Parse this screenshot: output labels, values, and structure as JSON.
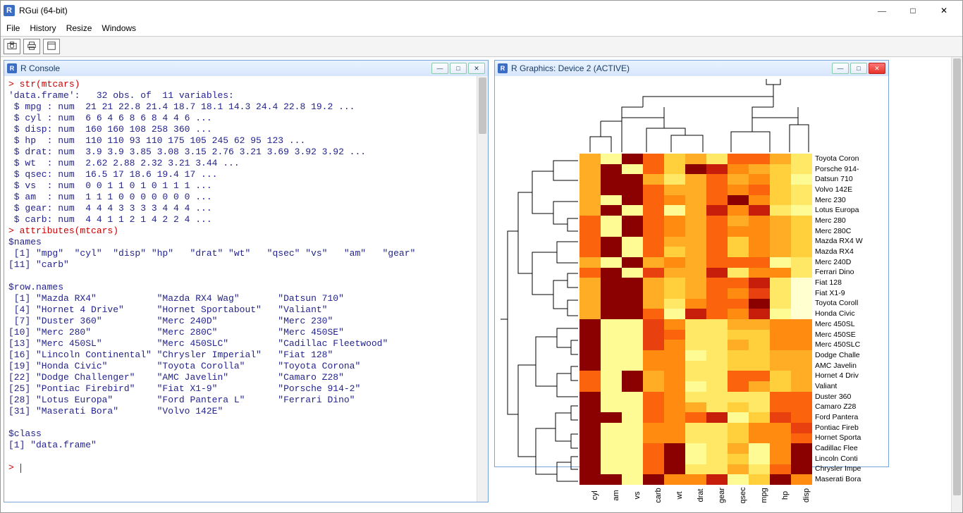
{
  "app": {
    "title": "RGui (64-bit)",
    "menus": [
      "File",
      "History",
      "Resize",
      "Windows"
    ]
  },
  "console": {
    "title": "R Console",
    "lines": [
      {
        "s": "cmd",
        "t": "> str(mtcars)"
      },
      {
        "s": "out",
        "t": "'data.frame':   32 obs. of  11 variables:"
      },
      {
        "s": "out",
        "t": " $ mpg : num  21 21 22.8 21.4 18.7 18.1 14.3 24.4 22.8 19.2 ..."
      },
      {
        "s": "out",
        "t": " $ cyl : num  6 6 4 6 8 6 8 4 4 6 ..."
      },
      {
        "s": "out",
        "t": " $ disp: num  160 160 108 258 360 ..."
      },
      {
        "s": "out",
        "t": " $ hp  : num  110 110 93 110 175 105 245 62 95 123 ..."
      },
      {
        "s": "out",
        "t": " $ drat: num  3.9 3.9 3.85 3.08 3.15 2.76 3.21 3.69 3.92 3.92 ..."
      },
      {
        "s": "out",
        "t": " $ wt  : num  2.62 2.88 2.32 3.21 3.44 ..."
      },
      {
        "s": "out",
        "t": " $ qsec: num  16.5 17 18.6 19.4 17 ..."
      },
      {
        "s": "out",
        "t": " $ vs  : num  0 0 1 1 0 1 0 1 1 1 ..."
      },
      {
        "s": "out",
        "t": " $ am  : num  1 1 1 0 0 0 0 0 0 0 ..."
      },
      {
        "s": "out",
        "t": " $ gear: num  4 4 4 3 3 3 3 4 4 4 ..."
      },
      {
        "s": "out",
        "t": " $ carb: num  4 4 1 1 2 1 4 2 2 4 ..."
      },
      {
        "s": "cmd",
        "t": "> attributes(mtcars)"
      },
      {
        "s": "out",
        "t": "$names"
      },
      {
        "s": "out",
        "t": " [1] \"mpg\"  \"cyl\"  \"disp\" \"hp\"   \"drat\" \"wt\"   \"qsec\" \"vs\"   \"am\"   \"gear\""
      },
      {
        "s": "out",
        "t": "[11] \"carb\""
      },
      {
        "s": "out",
        "t": ""
      },
      {
        "s": "out",
        "t": "$row.names"
      },
      {
        "s": "out",
        "t": " [1] \"Mazda RX4\"           \"Mazda RX4 Wag\"       \"Datsun 710\""
      },
      {
        "s": "out",
        "t": " [4] \"Hornet 4 Drive\"      \"Hornet Sportabout\"   \"Valiant\""
      },
      {
        "s": "out",
        "t": " [7] \"Duster 360\"          \"Merc 240D\"           \"Merc 230\""
      },
      {
        "s": "out",
        "t": "[10] \"Merc 280\"            \"Merc 280C\"           \"Merc 450SE\""
      },
      {
        "s": "out",
        "t": "[13] \"Merc 450SL\"          \"Merc 450SLC\"         \"Cadillac Fleetwood\""
      },
      {
        "s": "out",
        "t": "[16] \"Lincoln Continental\" \"Chrysler Imperial\"   \"Fiat 128\""
      },
      {
        "s": "out",
        "t": "[19] \"Honda Civic\"         \"Toyota Corolla\"      \"Toyota Corona\""
      },
      {
        "s": "out",
        "t": "[22] \"Dodge Challenger\"    \"AMC Javelin\"         \"Camaro Z28\""
      },
      {
        "s": "out",
        "t": "[25] \"Pontiac Firebird\"    \"Fiat X1-9\"           \"Porsche 914-2\""
      },
      {
        "s": "out",
        "t": "[28] \"Lotus Europa\"        \"Ford Pantera L\"      \"Ferrari Dino\""
      },
      {
        "s": "out",
        "t": "[31] \"Maserati Bora\"       \"Volvo 142E\""
      },
      {
        "s": "out",
        "t": ""
      },
      {
        "s": "out",
        "t": "$class"
      },
      {
        "s": "out",
        "t": "[1] \"data.frame\""
      },
      {
        "s": "out",
        "t": ""
      },
      {
        "s": "cmd",
        "t": "> "
      }
    ]
  },
  "graphics": {
    "title": "R Graphics: Device 2 (ACTIVE)"
  },
  "chart_data": {
    "type": "heatmap",
    "title": "",
    "x": [
      "cyl",
      "am",
      "vs",
      "carb",
      "wt",
      "drat",
      "gear",
      "qsec",
      "mpg",
      "hp",
      "disp"
    ],
    "y": [
      "Toyota Coron",
      "Porsche 914-",
      "Datsun 710",
      "Volvo 142E",
      "Merc 230",
      "Lotus Europa",
      "Merc 280",
      "Merc 280C",
      "Mazda RX4 W",
      "Mazda RX4",
      "Merc 240D",
      "Ferrari Dino",
      "Fiat 128",
      "Fiat X1-9",
      "Toyota Coroll",
      "Honda Civic",
      "Merc 450SL",
      "Merc 450SE",
      "Merc 450SLC",
      "Dodge Challe",
      "AMC Javelin",
      "Hornet 4 Driv",
      "Valiant",
      "Duster 360",
      "Camaro Z28",
      "Ford Pantera",
      "Pontiac Fireb",
      "Hornet Sporta",
      "Cadillac Flee",
      "Lincoln Conti",
      "Chrysler Impe",
      "Maserati Bora"
    ],
    "palette": [
      "#8b0000",
      "#c61e0a",
      "#e8400e",
      "#fb640d",
      "#ff8c11",
      "#ffad24",
      "#ffcf3c",
      "#ffe866",
      "#fffb94",
      "#ffffd0"
    ],
    "values": [
      [
        5,
        8,
        0,
        3,
        6,
        5,
        7,
        3,
        3,
        5,
        7
      ],
      [
        5,
        0,
        8,
        3,
        6,
        0,
        1,
        4,
        5,
        6,
        7
      ],
      [
        5,
        0,
        0,
        5,
        7,
        5,
        3,
        5,
        4,
        6,
        8
      ],
      [
        5,
        0,
        0,
        3,
        5,
        5,
        3,
        4,
        3,
        6,
        7
      ],
      [
        5,
        8,
        0,
        3,
        4,
        5,
        3,
        0,
        4,
        6,
        7
      ],
      [
        5,
        0,
        8,
        3,
        8,
        5,
        1,
        4,
        1,
        7,
        8
      ],
      [
        3,
        8,
        0,
        3,
        4,
        5,
        3,
        5,
        4,
        5,
        6
      ],
      [
        3,
        8,
        0,
        3,
        4,
        5,
        3,
        4,
        4,
        5,
        6
      ],
      [
        3,
        0,
        8,
        3,
        5,
        5,
        3,
        6,
        4,
        5,
        6
      ],
      [
        3,
        0,
        8,
        3,
        6,
        5,
        3,
        6,
        4,
        5,
        6
      ],
      [
        5,
        8,
        0,
        5,
        4,
        5,
        3,
        3,
        3,
        8,
        7
      ],
      [
        3,
        0,
        8,
        2,
        5,
        5,
        1,
        7,
        4,
        4,
        7
      ],
      [
        5,
        0,
        0,
        5,
        6,
        5,
        3,
        3,
        1,
        7,
        9
      ],
      [
        5,
        0,
        0,
        5,
        6,
        5,
        3,
        4,
        2,
        7,
        9
      ],
      [
        5,
        0,
        0,
        5,
        7,
        4,
        3,
        3,
        0,
        7,
        9
      ],
      [
        5,
        0,
        0,
        3,
        8,
        1,
        3,
        4,
        1,
        8,
        9
      ],
      [
        0,
        8,
        8,
        2,
        4,
        7,
        7,
        5,
        5,
        4,
        4
      ],
      [
        0,
        8,
        8,
        2,
        3,
        7,
        7,
        6,
        6,
        4,
        4
      ],
      [
        0,
        8,
        8,
        2,
        4,
        7,
        7,
        5,
        6,
        4,
        4
      ],
      [
        0,
        8,
        8,
        4,
        4,
        8,
        7,
        6,
        6,
        5,
        5
      ],
      [
        0,
        8,
        8,
        4,
        4,
        7,
        7,
        6,
        6,
        5,
        5
      ],
      [
        3,
        8,
        0,
        5,
        4,
        7,
        7,
        3,
        3,
        6,
        5
      ],
      [
        3,
        8,
        0,
        5,
        4,
        8,
        7,
        3,
        5,
        6,
        5
      ],
      [
        0,
        8,
        8,
        3,
        4,
        7,
        7,
        7,
        7,
        3,
        3
      ],
      [
        0,
        8,
        8,
        3,
        4,
        5,
        7,
        6,
        7,
        3,
        3
      ],
      [
        0,
        0,
        8,
        3,
        4,
        3,
        1,
        8,
        6,
        2,
        3
      ],
      [
        0,
        8,
        8,
        4,
        4,
        7,
        7,
        6,
        4,
        4,
        2
      ],
      [
        0,
        8,
        8,
        4,
        4,
        7,
        7,
        6,
        4,
        4,
        3
      ],
      [
        0,
        8,
        8,
        3,
        0,
        8,
        7,
        5,
        8,
        4,
        0
      ],
      [
        0,
        8,
        8,
        3,
        0,
        8,
        7,
        6,
        8,
        4,
        0
      ],
      [
        0,
        8,
        8,
        3,
        0,
        7,
        7,
        5,
        7,
        3,
        0
      ],
      [
        0,
        0,
        8,
        0,
        4,
        4,
        1,
        8,
        6,
        0,
        4
      ]
    ]
  }
}
